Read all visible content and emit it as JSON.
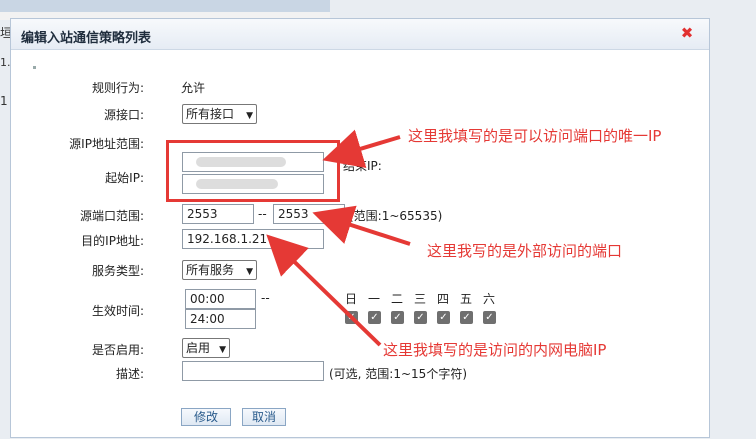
{
  "background": {
    "left_marks": [
      "垣",
      "1.2",
      "1"
    ]
  },
  "dialog": {
    "title": "编辑入站通信策略列表",
    "close_icon": "close-icon"
  },
  "form": {
    "rule_action_label": "规则行为:",
    "rule_action_value": "允许",
    "source_interface_label": "源接口:",
    "source_interface_value": "所有接口",
    "source_ip_range_label": "源IP地址范围:",
    "start_ip_label": "起始IP:",
    "end_ip_label": "结束IP:",
    "source_port_range_label": "源端口范围:",
    "source_port_start": "2553",
    "source_port_end": "2553",
    "port_separator": "--",
    "port_range_hint": "(范围:1~65535)",
    "dest_ip_label": "目的IP地址:",
    "dest_ip_value": "192.168.1.21",
    "service_type_label": "服务类型:",
    "service_type_value": "所有服务",
    "effective_time_label": "生效时间:",
    "time_start": "00:00",
    "time_end": "24:00",
    "time_separator": "--",
    "days": [
      "日",
      "一",
      "二",
      "三",
      "四",
      "五",
      "六"
    ],
    "enabled_label": "是否启用:",
    "enabled_value": "启用",
    "description_label": "描述:",
    "description_value": "",
    "description_hint": "(可选, 范围:1~15个字符)",
    "modify_button": "修改",
    "cancel_button": "取消"
  },
  "annotations": {
    "note_ip": "这里我填写的是可以访问端口的唯一IP",
    "note_port": "这里我写的是外部访问的端口",
    "note_internal_ip": "这里我填写的是访问的内网电脑IP",
    "color": "#e53935"
  }
}
